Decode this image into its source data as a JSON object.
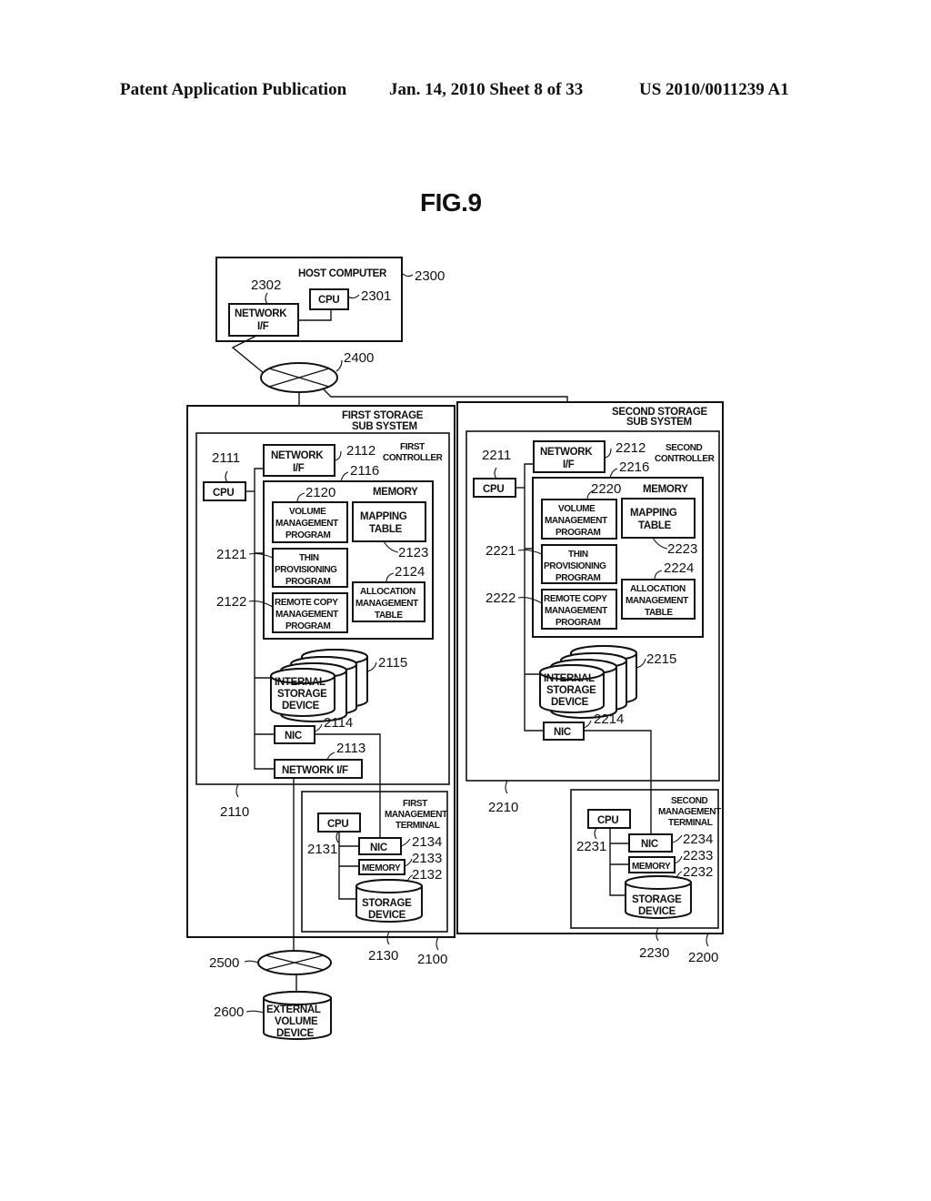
{
  "header": {
    "left": "Patent Application Publication",
    "middle": "Jan. 14, 2010  Sheet 8 of 33",
    "right": "US 2010/0011239 A1"
  },
  "figure": {
    "title": "FIG.9"
  },
  "host": {
    "title": "HOST COMPUTER",
    "ref": "2300",
    "cpu": {
      "label": "CPU",
      "ref": "2301"
    },
    "nif": {
      "label1": "NETWORK",
      "label2": "I/F",
      "ref": "2302"
    }
  },
  "network_top": {
    "ref": "2400"
  },
  "network_bottom": {
    "ref": "2500"
  },
  "external": {
    "label1": "EXTERNAL",
    "label2": "VOLUME",
    "label3": "DEVICE",
    "ref": "2600"
  },
  "first": {
    "title1": "FIRST STORAGE",
    "title2": "SUB SYSTEM",
    "ref": "2100",
    "controller": {
      "title1": "FIRST",
      "title2": "CONTROLLER",
      "ref": "2110"
    },
    "cpu": {
      "label": "CPU",
      "ref": "2111"
    },
    "nif": {
      "label1": "NETWORK",
      "label2": "I/F",
      "ref": "2112"
    },
    "memory": {
      "title": "MEMORY",
      "ref": "2116"
    },
    "vmp": {
      "l1": "VOLUME",
      "l2": "MANAGEMENT",
      "l3": "PROGRAM",
      "ref": "2120"
    },
    "tpp": {
      "l1": "THIN",
      "l2": "PROVISIONING",
      "l3": "PROGRAM",
      "ref": "2121"
    },
    "rcp": {
      "l1": "REMOTE COPY",
      "l2": "MANAGEMENT",
      "l3": "PROGRAM",
      "ref": "2122"
    },
    "map": {
      "l1": "MAPPING",
      "l2": "TABLE",
      "ref": "2123"
    },
    "alloc": {
      "l1": "ALLOCATION",
      "l2": "MANAGEMENT",
      "l3": "TABLE",
      "ref": "2124"
    },
    "isd": {
      "l1": "INTERNAL",
      "l2": "STORAGE",
      "l3": "DEVICE",
      "ref": "2115"
    },
    "nic": {
      "label": "NIC",
      "ref": "2114"
    },
    "nif2": {
      "label": "NETWORK I/F",
      "ref": "2113"
    },
    "terminal": {
      "title1": "FIRST",
      "title2": "MANAGEMENT",
      "title3": "TERMINAL",
      "ref": "2130",
      "cpu": {
        "label": "CPU",
        "ref": "2131"
      },
      "nic": {
        "label": "NIC",
        "ref": "2134"
      },
      "memory": {
        "label": "MEMORY",
        "ref": "2133"
      },
      "storage": {
        "l1": "STORAGE",
        "l2": "DEVICE",
        "ref": "2132"
      }
    }
  },
  "second": {
    "title1": "SECOND STORAGE",
    "title2": "SUB SYSTEM",
    "ref": "2200",
    "controller": {
      "title1": "SECOND",
      "title2": "CONTROLLER",
      "ref": "2210"
    },
    "cpu": {
      "label": "CPU",
      "ref": "2211"
    },
    "nif": {
      "label1": "NETWORK",
      "label2": "I/F",
      "ref": "2212"
    },
    "memory": {
      "title": "MEMORY",
      "ref": "2216"
    },
    "vmp": {
      "l1": "VOLUME",
      "l2": "MANAGEMENT",
      "l3": "PROGRAM",
      "ref": "2220"
    },
    "tpp": {
      "l1": "THIN",
      "l2": "PROVISIONING",
      "l3": "PROGRAM",
      "ref": "2221"
    },
    "rcp": {
      "l1": "REMOTE COPY",
      "l2": "MANAGEMENT",
      "l3": "PROGRAM",
      "ref": "2222"
    },
    "map": {
      "l1": "MAPPING",
      "l2": "TABLE",
      "ref": "2223"
    },
    "alloc": {
      "l1": "ALLOCATION",
      "l2": "MANAGEMENT",
      "l3": "TABLE",
      "ref": "2224"
    },
    "isd": {
      "l1": "INTERNAL",
      "l2": "STORAGE",
      "l3": "DEVICE",
      "ref": "2215"
    },
    "nic": {
      "label": "NIC",
      "ref": "2214"
    },
    "terminal": {
      "title1": "SECOND",
      "title2": "MANAGEMENT",
      "title3": "TERMINAL",
      "ref": "2230",
      "cpu": {
        "label": "CPU",
        "ref": "2231"
      },
      "nic": {
        "label": "NIC",
        "ref": "2234"
      },
      "memory": {
        "label": "MEMORY",
        "ref": "2233"
      },
      "storage": {
        "l1": "STORAGE",
        "l2": "DEVICE",
        "ref": "2232"
      }
    }
  }
}
